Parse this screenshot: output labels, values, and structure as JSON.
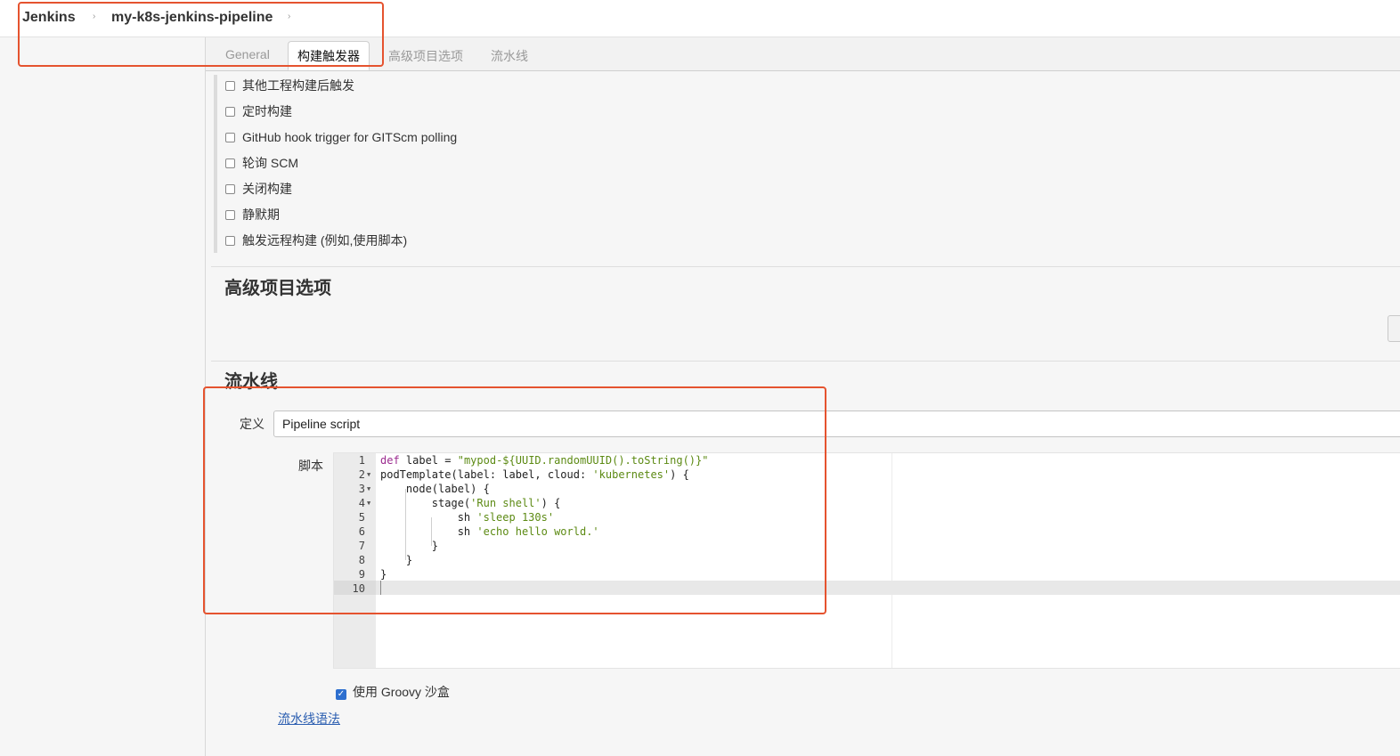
{
  "breadcrumb": {
    "root": "Jenkins",
    "job": "my-k8s-jenkins-pipeline",
    "separator": "›"
  },
  "tabs": [
    {
      "label": "General",
      "active": false
    },
    {
      "label": "构建触发器",
      "active": true
    },
    {
      "label": "高级项目选项",
      "active": false
    },
    {
      "label": "流水线",
      "active": false
    }
  ],
  "triggers": [
    {
      "label": "其他工程构建后触发",
      "checked": false
    },
    {
      "label": "定时构建",
      "checked": false
    },
    {
      "label": "GitHub hook trigger for GITScm polling",
      "checked": false
    },
    {
      "label": "轮询 SCM",
      "checked": false
    },
    {
      "label": "关闭构建",
      "checked": false
    },
    {
      "label": "静默期",
      "checked": false
    },
    {
      "label": "触发远程构建 (例如,使用脚本)",
      "checked": false
    }
  ],
  "advanced_section": {
    "title": "高级项目选项"
  },
  "pipeline_section": {
    "title": "流水线",
    "definition_label": "定义",
    "definition_value": "Pipeline script",
    "script_label": "脚本",
    "line_numbers": [
      "1",
      "2",
      "3",
      "4",
      "5",
      "6",
      "7",
      "8",
      "9",
      "10"
    ],
    "foldable_lines": [
      2,
      3,
      4
    ],
    "active_line": 10,
    "sandbox_label": "使用 Groovy 沙盒",
    "sandbox_checked": true,
    "syntax_link": "流水线语法"
  },
  "colors": {
    "annotation_box": "#e5532f",
    "keyword": "#9b2b8f",
    "string": "#5c8a13",
    "link": "#2a5db0",
    "checkbox_checked": "#2d6fcf"
  },
  "icons": {
    "breadcrumb_separator": "chevron-right-icon",
    "fold_toggle": "fold-arrow-icon",
    "checkbox_checked": "checkmark-icon"
  }
}
